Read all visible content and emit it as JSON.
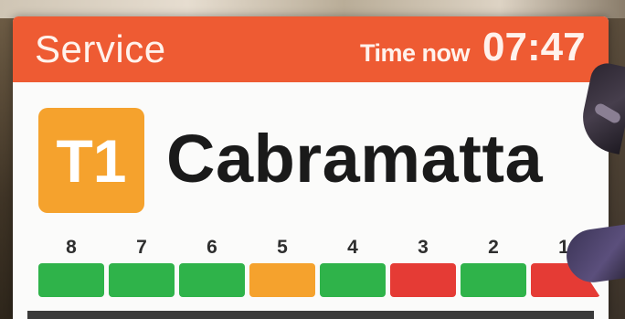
{
  "header": {
    "title": "Service",
    "time_label": "Time now",
    "time_value": "07:47",
    "color": "#ee5b33"
  },
  "line": {
    "code": "T1",
    "color": "#f5a22d"
  },
  "station": {
    "name": "Cabramatta"
  },
  "cars": [
    {
      "number": "8",
      "status_color": "#2fb34a"
    },
    {
      "number": "7",
      "status_color": "#2fb34a"
    },
    {
      "number": "6",
      "status_color": "#2fb34a"
    },
    {
      "number": "5",
      "status_color": "#f5a22d"
    },
    {
      "number": "4",
      "status_color": "#2fb34a"
    },
    {
      "number": "3",
      "status_color": "#e53b35"
    },
    {
      "number": "2",
      "status_color": "#2fb34a"
    },
    {
      "number": "1",
      "status_color": "#e53b35"
    }
  ]
}
